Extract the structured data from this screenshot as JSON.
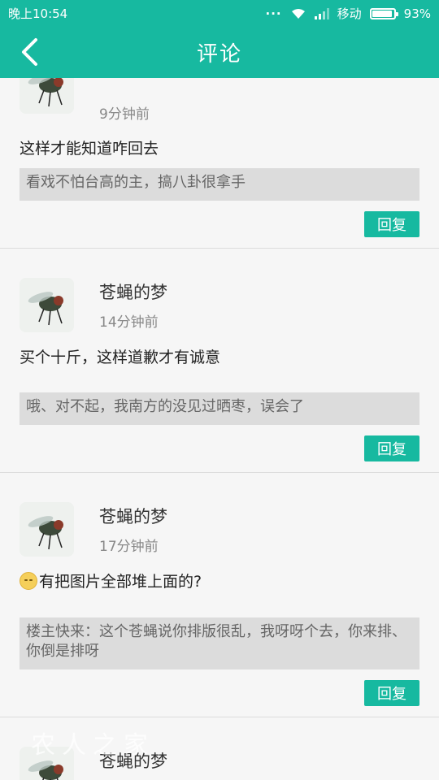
{
  "status_bar": {
    "time": "晚上10:54",
    "carrier": "移动",
    "battery": "93%"
  },
  "header": {
    "title": "评论",
    "back_icon": "chevron-left-icon"
  },
  "comments": [
    {
      "time_ago": "9分钟前",
      "content": "这样才能知道咋回去",
      "reply": "看戏不怕台高的主，搞八卦很拿手",
      "reply_button": "回复"
    },
    {
      "username": "苍蝇的梦",
      "time_ago": "14分钟前",
      "content": "买个十斤，这样道歉才有诚意",
      "reply": "哦、对不起，我南方的没见过晒枣，误会了",
      "reply_button": "回复"
    },
    {
      "username": "苍蝇的梦",
      "time_ago": "17分钟前",
      "content": "有把图片全部堆上面的?",
      "reply": "楼主快来：这个苍蝇说你排版很乱，我呀呀个去，你来排、你倒是排呀",
      "reply_button": "回复"
    },
    {
      "username": "苍蝇的梦"
    }
  ],
  "watermark": "农人之家",
  "colors": {
    "accent": "#17b9a0",
    "reply_bg": "#dcdcdc"
  }
}
